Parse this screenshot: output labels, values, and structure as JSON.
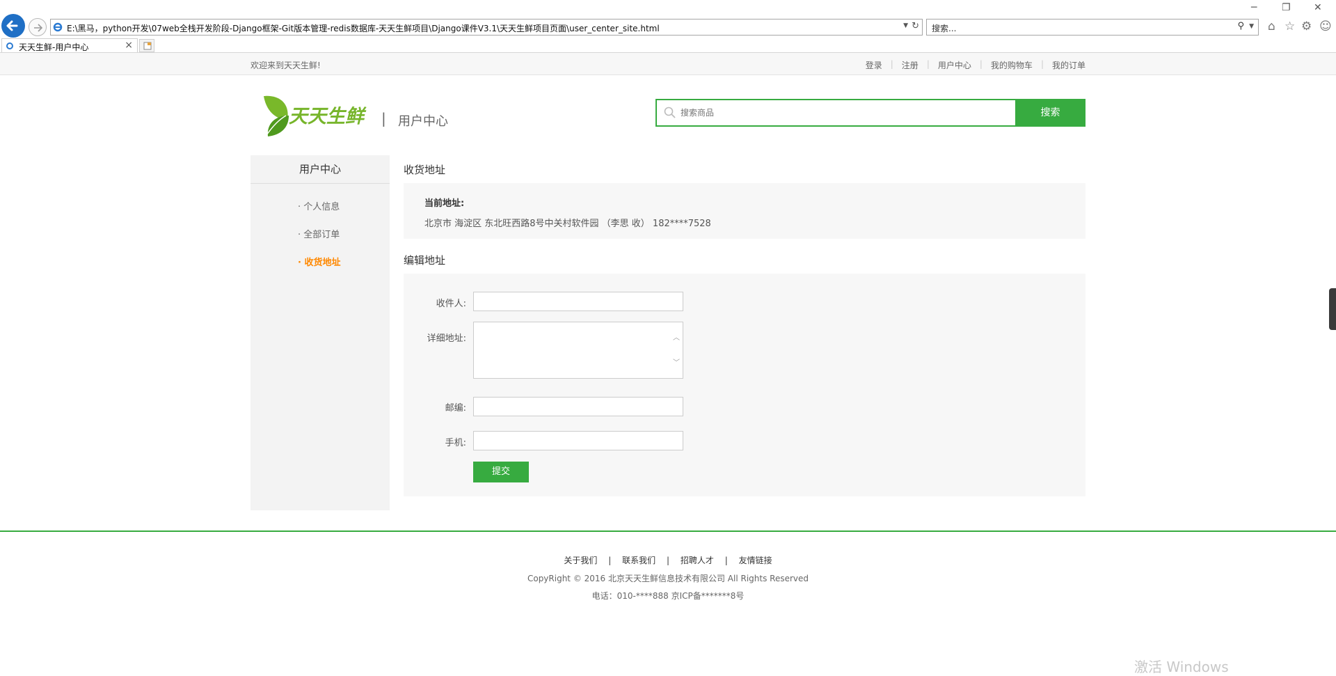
{
  "browser": {
    "url": "E:\\黑马，python开发\\07web全栈开发阶段-Django框架-Git版本管理-redis数据库-天天生鲜项目\\Django课件V3.1\\天天生鲜项目页面\\user_center_site.html",
    "search_placeholder": "搜索...",
    "tab_title": "天天生鲜-用户中心"
  },
  "topbar": {
    "welcome": "欢迎来到天天生鲜!",
    "links": [
      "登录",
      "注册",
      "用户中心",
      "我的购物车",
      "我的订单"
    ]
  },
  "header": {
    "logo_text": "天天生鲜",
    "divider": "|",
    "subtitle": "用户中心",
    "search_placeholder": "搜索商品",
    "search_button": "搜索"
  },
  "left_menu": {
    "title": "用户中心",
    "items": [
      {
        "label": "· 个人信息"
      },
      {
        "label": "· 全部订单"
      },
      {
        "label": "· 收货地址"
      }
    ],
    "active_index": 2
  },
  "current_address": {
    "section_title": "收货地址",
    "label": "当前地址:",
    "value": "北京市 海淀区 东北旺西路8号中关村软件园 （李思 收） 182****7528"
  },
  "edit_address": {
    "section_title": "编辑地址",
    "receiver_label": "收件人:",
    "receiver_value": "",
    "detail_label": "详细地址:",
    "detail_value": "",
    "zip_label": "邮编:",
    "zip_value": "",
    "phone_label": "手机:",
    "phone_value": "",
    "submit_label": "提交"
  },
  "footer": {
    "links": [
      "关于我们",
      "联系我们",
      "招聘人才",
      "友情链接"
    ],
    "separator": "|",
    "copyright": "CopyRight © 2016 北京天天生鲜信息技术有限公司 All Rights Reserved",
    "tel": "电话：010-****888 京ICP备*******8号"
  },
  "watermark": "激活 Windows",
  "colors": {
    "brand_green": "#37ab40",
    "active_orange": "#ff8800",
    "menu_bg": "#f3f3f3"
  }
}
